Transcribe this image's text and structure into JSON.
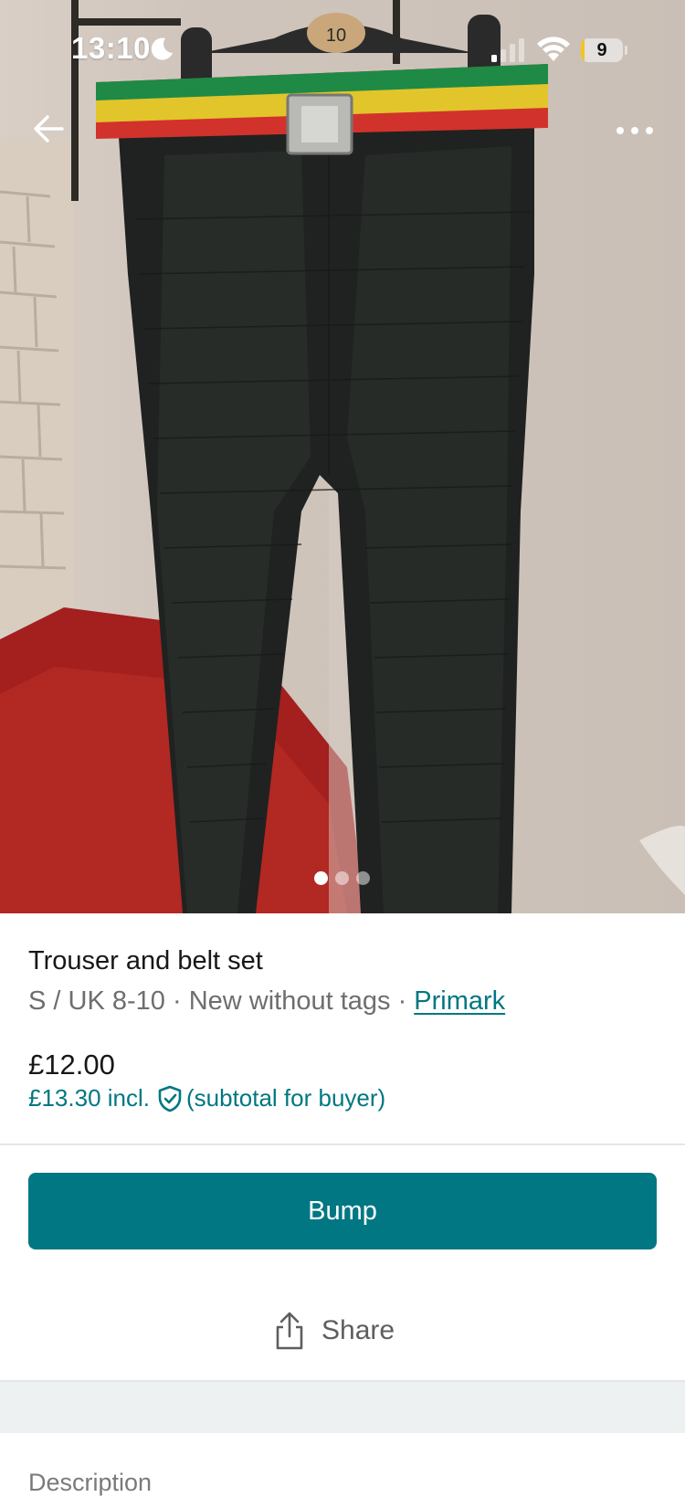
{
  "status_bar": {
    "time": "13:10",
    "battery_level": "9",
    "battery_fraction": 0.09,
    "battery_color": "#f4c51b"
  },
  "photo": {
    "hanger_size_label": "10",
    "page_dots": {
      "count": 3,
      "active": 1
    }
  },
  "nav": {
    "back_icon": "arrow-left-icon",
    "more_icon": "more-horizontal-icon"
  },
  "item": {
    "title": "Trouser and belt set",
    "size": "S / UK 8-10",
    "separator": " · ",
    "condition": "New without tags",
    "brand": "Primark",
    "price": "£12.00",
    "price_incl": "£13.30 incl.",
    "price_incl_note": "(subtotal for buyer)",
    "protection_icon": "shield-check-icon"
  },
  "actions": {
    "bump_label": "Bump",
    "share_label": "Share",
    "share_icon": "share-icon"
  },
  "sections": {
    "description_label": "Description"
  },
  "colors": {
    "accent": "#007782",
    "bump_text": "#ffffff"
  }
}
